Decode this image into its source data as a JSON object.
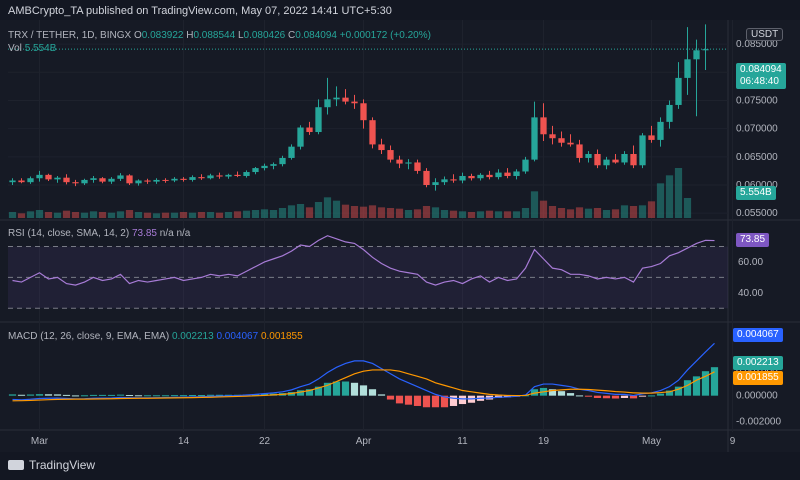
{
  "header": "AMBCrypto_TA published on TradingView.com, May 07, 2022 14:41 UTC+5:30",
  "footer": {
    "brand": "TradingView"
  },
  "colors": {
    "up": "#26a69a",
    "down": "#ef5350",
    "rsi": "#a77bd6",
    "macd": "#2962ff",
    "signal": "#ff9800",
    "hist_up_light": "#b2dfdb",
    "hist_dn_light": "#ffcdd2"
  },
  "price_panel": {
    "legend_symbol": "TRX / TETHER, 1D, BINGX",
    "o_label": "O",
    "o": "0.083922",
    "h_label": "H",
    "h": "0.088544",
    "l_label": "L",
    "l": "0.080426",
    "c_label": "C",
    "c": "0.084094",
    "change": "+0.000172 (+0.20%)",
    "vol_label": "Vol",
    "vol": "5.554B",
    "currency": "USDT",
    "price_badge": "0.084094",
    "countdown": "06:48:40",
    "vol_badge": "5.554B"
  },
  "rsi_panel": {
    "legend_label": "RSI (14, close, SMA, 14, 2)",
    "value": "73.85",
    "na1": "n/a",
    "na2": "n/a",
    "badge": "73.85"
  },
  "macd_panel": {
    "legend_label": "MACD (12, 26, close, 9, EMA, EMA)",
    "macd": "0.002213",
    "signal": "0.004067",
    "hist": "0.001855",
    "badge_macd": "0.004067",
    "badge_hist": "0.002213",
    "badge_signal": "0.001855"
  },
  "chart_data": [
    {
      "type": "candlestick",
      "title": "TRX / TETHER, 1D, BINGX",
      "ylim": [
        0.0545,
        0.0875
      ],
      "yticks": [
        "0.085000",
        "0.080000",
        "0.075000",
        "0.070000",
        "0.065000",
        "0.060000",
        "0.055000"
      ],
      "ytick_values": [
        0.085,
        0.08,
        0.075,
        0.07,
        0.065,
        0.06,
        0.055
      ],
      "xticks": [
        "Mar",
        "14",
        "22",
        "Apr",
        "11",
        "19",
        "May",
        "9"
      ],
      "xtick_index": [
        3,
        19,
        28,
        39,
        50,
        59,
        71,
        80
      ],
      "candles": [
        [
          0.0605,
          0.0612,
          0.06,
          0.0608
        ],
        [
          0.0608,
          0.0612,
          0.0603,
          0.0605
        ],
        [
          0.0605,
          0.0615,
          0.0602,
          0.0612
        ],
        [
          0.0612,
          0.0625,
          0.0606,
          0.0618
        ],
        [
          0.0618,
          0.062,
          0.0607,
          0.061
        ],
        [
          0.061,
          0.0616,
          0.0604,
          0.0613
        ],
        [
          0.0613,
          0.0619,
          0.0601,
          0.0605
        ],
        [
          0.0605,
          0.0609,
          0.0598,
          0.0603
        ],
        [
          0.0603,
          0.0611,
          0.06,
          0.0609
        ],
        [
          0.0609,
          0.0616,
          0.0604,
          0.0612
        ],
        [
          0.0612,
          0.0614,
          0.0603,
          0.0606
        ],
        [
          0.0606,
          0.0614,
          0.0602,
          0.0611
        ],
        [
          0.0611,
          0.0621,
          0.0607,
          0.0617
        ],
        [
          0.0617,
          0.0619,
          0.06,
          0.0603
        ],
        [
          0.0603,
          0.061,
          0.0599,
          0.0608
        ],
        [
          0.0608,
          0.0611,
          0.0602,
          0.0606
        ],
        [
          0.0606,
          0.0612,
          0.0602,
          0.0609
        ],
        [
          0.0609,
          0.0612,
          0.0604,
          0.0608
        ],
        [
          0.0608,
          0.0614,
          0.0605,
          0.0611
        ],
        [
          0.0611,
          0.0614,
          0.0606,
          0.0609
        ],
        [
          0.0609,
          0.0617,
          0.0606,
          0.0614
        ],
        [
          0.0614,
          0.0619,
          0.0609,
          0.0612
        ],
        [
          0.0612,
          0.062,
          0.061,
          0.0617
        ],
        [
          0.0617,
          0.0622,
          0.0611,
          0.0615
        ],
        [
          0.0615,
          0.062,
          0.0611,
          0.0618
        ],
        [
          0.0618,
          0.0624,
          0.0614,
          0.0616
        ],
        [
          0.0616,
          0.0626,
          0.0613,
          0.0623
        ],
        [
          0.0623,
          0.0632,
          0.0619,
          0.063
        ],
        [
          0.063,
          0.0638,
          0.0626,
          0.0634
        ],
        [
          0.0634,
          0.064,
          0.0628,
          0.0637
        ],
        [
          0.0637,
          0.0652,
          0.0633,
          0.0648
        ],
        [
          0.0648,
          0.0672,
          0.0645,
          0.0668
        ],
        [
          0.0668,
          0.0706,
          0.0663,
          0.0702
        ],
        [
          0.0702,
          0.0712,
          0.0689,
          0.0694
        ],
        [
          0.0694,
          0.0752,
          0.069,
          0.0738
        ],
        [
          0.0738,
          0.079,
          0.0725,
          0.0752
        ],
        [
          0.0752,
          0.0775,
          0.074,
          0.0755
        ],
        [
          0.0755,
          0.077,
          0.0743,
          0.0748
        ],
        [
          0.0748,
          0.076,
          0.0735,
          0.0745
        ],
        [
          0.0745,
          0.0752,
          0.07,
          0.0715
        ],
        [
          0.0715,
          0.072,
          0.0665,
          0.0672
        ],
        [
          0.0672,
          0.0682,
          0.0655,
          0.0662
        ],
        [
          0.0662,
          0.067,
          0.064,
          0.0645
        ],
        [
          0.0645,
          0.0652,
          0.063,
          0.0638
        ],
        [
          0.0638,
          0.0646,
          0.0628,
          0.064
        ],
        [
          0.064,
          0.0645,
          0.062,
          0.0625
        ],
        [
          0.0625,
          0.063,
          0.0596,
          0.06
        ],
        [
          0.06,
          0.0612,
          0.059,
          0.0605
        ],
        [
          0.0605,
          0.0615,
          0.06,
          0.061
        ],
        [
          0.061,
          0.0619,
          0.0604,
          0.0608
        ],
        [
          0.0608,
          0.0622,
          0.0603,
          0.0616
        ],
        [
          0.0616,
          0.062,
          0.0608,
          0.0612
        ],
        [
          0.0612,
          0.0621,
          0.0608,
          0.0618
        ],
        [
          0.0618,
          0.0625,
          0.061,
          0.0614
        ],
        [
          0.0614,
          0.0628,
          0.061,
          0.0622
        ],
        [
          0.0622,
          0.063,
          0.0612,
          0.0616
        ],
        [
          0.0616,
          0.0628,
          0.061,
          0.0624
        ],
        [
          0.0624,
          0.065,
          0.062,
          0.0645
        ],
        [
          0.0645,
          0.0748,
          0.0642,
          0.072
        ],
        [
          0.072,
          0.0745,
          0.0678,
          0.069
        ],
        [
          0.069,
          0.0705,
          0.0672,
          0.0683
        ],
        [
          0.0683,
          0.0695,
          0.0668,
          0.0675
        ],
        [
          0.0675,
          0.069,
          0.0668,
          0.0672
        ],
        [
          0.0672,
          0.068,
          0.064,
          0.0648
        ],
        [
          0.0648,
          0.066,
          0.064,
          0.0655
        ],
        [
          0.0655,
          0.0663,
          0.063,
          0.0635
        ],
        [
          0.0635,
          0.065,
          0.0628,
          0.0645
        ],
        [
          0.0645,
          0.0655,
          0.0638,
          0.064
        ],
        [
          0.064,
          0.066,
          0.0636,
          0.0655
        ],
        [
          0.0655,
          0.067,
          0.063,
          0.0635
        ],
        [
          0.0635,
          0.0692,
          0.063,
          0.0688
        ],
        [
          0.0688,
          0.0705,
          0.0675,
          0.068
        ],
        [
          0.068,
          0.072,
          0.0668,
          0.0712
        ],
        [
          0.0712,
          0.075,
          0.07,
          0.0742
        ],
        [
          0.0742,
          0.0818,
          0.0735,
          0.079
        ],
        [
          0.079,
          0.088,
          0.076,
          0.0823
        ],
        [
          0.0823,
          0.0858,
          0.0722,
          0.0839
        ],
        [
          0.0839,
          0.0885,
          0.0804,
          0.0841
        ]
      ],
      "volume": [
        0.9,
        0.7,
        1.0,
        1.2,
        0.9,
        0.8,
        1.1,
        0.9,
        0.8,
        1.0,
        0.9,
        0.8,
        1.0,
        1.2,
        0.9,
        0.8,
        0.7,
        0.8,
        0.8,
        0.9,
        0.8,
        0.9,
        0.9,
        0.8,
        0.9,
        1.0,
        1.1,
        1.2,
        1.3,
        1.2,
        1.5,
        1.9,
        2.1,
        1.6,
        2.4,
        3.1,
        2.6,
        2.0,
        1.8,
        1.7,
        1.9,
        1.6,
        1.5,
        1.4,
        1.2,
        1.3,
        1.8,
        1.6,
        1.2,
        1.1,
        1.0,
        0.9,
        1.0,
        1.1,
        1.0,
        1.0,
        1.0,
        1.5,
        4.0,
        2.6,
        1.8,
        1.5,
        1.3,
        1.6,
        1.4,
        1.5,
        1.2,
        1.3,
        1.9,
        1.8,
        1.9,
        2.5,
        5.2,
        6.4,
        7.5,
        3.0
      ],
      "vol_max": 9.0
    },
    {
      "type": "line",
      "title": "RSI (14, close, SMA, 14, 2)",
      "ylim": [
        25,
        82
      ],
      "yticks": [
        "60.00",
        "40.00"
      ],
      "ytick_values": [
        60,
        40
      ],
      "bands": [
        70,
        50,
        30
      ],
      "series": [
        {
          "values": [
            48,
            47,
            50,
            53,
            49,
            50,
            46,
            45,
            47,
            50,
            48,
            49,
            52,
            46,
            48,
            47,
            48,
            49,
            50,
            48,
            49,
            50,
            52,
            51,
            52,
            51,
            54,
            57,
            60,
            62,
            64,
            67,
            71,
            70,
            74,
            77,
            75,
            73,
            72,
            68,
            63,
            59,
            56,
            54,
            53,
            52,
            47,
            45,
            47,
            48,
            46,
            49,
            51,
            47,
            50,
            48,
            49,
            56,
            68,
            62,
            56,
            55,
            52,
            52,
            51,
            49,
            50,
            49,
            50,
            47,
            56,
            57,
            59,
            64,
            66,
            69,
            72,
            74,
            73.85
          ]
        }
      ]
    },
    {
      "type": "line",
      "title": "MACD (12, 26, close, 9, EMA, EMA)",
      "ylim": [
        -0.0022,
        0.0051
      ],
      "yticks": [
        "0.002000",
        "0.000000",
        "-0.002000"
      ],
      "ytick_values": [
        0.002,
        0.0,
        -0.002
      ],
      "series": [
        {
          "values": [
            -0.0003,
            -0.00032,
            -0.00028,
            -0.00022,
            -0.0002,
            -0.00019,
            -0.00022,
            -0.00025,
            -0.00024,
            -0.0002,
            -0.00019,
            -0.00018,
            -0.00014,
            -0.00016,
            -0.00017,
            -0.00017,
            -0.00016,
            -0.00015,
            -0.00013,
            -0.00012,
            -0.0001,
            -8e-05,
            -5e-05,
            -3e-05,
            -1e-05,
            1e-05,
            5e-05,
            0.0001,
            0.00016,
            0.00022,
            0.0003,
            0.00045,
            0.0007,
            0.0009,
            0.0013,
            0.0018,
            0.0022,
            0.0025,
            0.0027,
            0.0027,
            0.0025,
            0.0021,
            0.0017,
            0.0013,
            0.001,
            0.0007,
            0.0004,
            0.0001,
            -0.0001,
            -0.0002,
            -0.00025,
            -0.00025,
            -0.0002,
            -0.00018,
            -0.00012,
            -0.0001,
            -5e-05,
            5e-05,
            0.0007,
            0.0009,
            0.0009,
            0.0008,
            0.0007,
            0.0005,
            0.0004,
            0.00025,
            0.00018,
            0.0001,
            0.0001,
            1e-05,
            0.00015,
            0.00022,
            0.0004,
            0.0007,
            0.0012,
            0.002,
            0.0027,
            0.0034,
            0.004067
          ]
        },
        {
          "values": [
            -0.0004,
            -0.00039,
            -0.00037,
            -0.00034,
            -0.00031,
            -0.00029,
            -0.00028,
            -0.00027,
            -0.00027,
            -0.00026,
            -0.00025,
            -0.00024,
            -0.00022,
            -0.00021,
            -0.0002,
            -0.0002,
            -0.00019,
            -0.00018,
            -0.00017,
            -0.00016,
            -0.00015,
            -0.00013,
            -0.00012,
            -0.0001,
            -8e-05,
            -6e-05,
            -4e-05,
            -1e-05,
            2e-05,
            6e-05,
            0.0001,
            0.00017,
            0.00028,
            0.0004,
            0.0006,
            0.0008,
            0.0011,
            0.0014,
            0.0017,
            0.0019,
            0.002,
            0.002,
            0.002,
            0.0019,
            0.0017,
            0.0015,
            0.0013,
            0.001,
            0.0008,
            0.0006,
            0.0004,
            0.0003,
            0.0002,
            0.0001,
            5e-05,
            2e-05,
            1e-05,
            2e-05,
            0.0002,
            0.0003,
            0.0004,
            0.00045,
            0.0005,
            0.0005,
            0.00048,
            0.00043,
            0.00038,
            0.00032,
            0.00028,
            0.00022,
            0.0002,
            0.0002,
            0.00024,
            0.0003,
            0.0005,
            0.0008,
            0.0012,
            0.0015,
            0.001855
          ]
        }
      ],
      "histogram": [
        0.0001,
        7e-05,
        9e-05,
        0.00012,
        0.00011,
        0.0001,
        6e-05,
        2e-05,
        3e-05,
        6e-05,
        6e-05,
        6e-05,
        8e-05,
        5e-05,
        3e-05,
        3e-05,
        3e-05,
        3e-05,
        4e-05,
        4e-05,
        5e-05,
        5e-05,
        7e-05,
        7e-05,
        7e-05,
        7e-05,
        9e-05,
        0.00011,
        0.00014,
        0.00016,
        0.0002,
        0.00028,
        0.00042,
        0.0005,
        0.0007,
        0.001,
        0.0011,
        0.0011,
        0.001,
        0.0008,
        0.0005,
        0.0001,
        -0.0003,
        -0.0006,
        -0.0007,
        -0.0008,
        -0.0009,
        -0.0009,
        -0.0009,
        -0.0008,
        -0.00065,
        -0.00055,
        -0.0004,
        -0.0003,
        -0.00017,
        -0.00012,
        -6e-05,
        3e-05,
        0.0005,
        0.0006,
        0.0005,
        0.00035,
        0.0002,
        2e-05,
        -8e-05,
        -0.00018,
        -0.0002,
        -0.00022,
        -0.00018,
        -0.00021,
        -5e-05,
        2e-05,
        0.00016,
        0.0004,
        0.0007,
        0.0012,
        0.0015,
        0.0019,
        0.002213
      ]
    }
  ]
}
